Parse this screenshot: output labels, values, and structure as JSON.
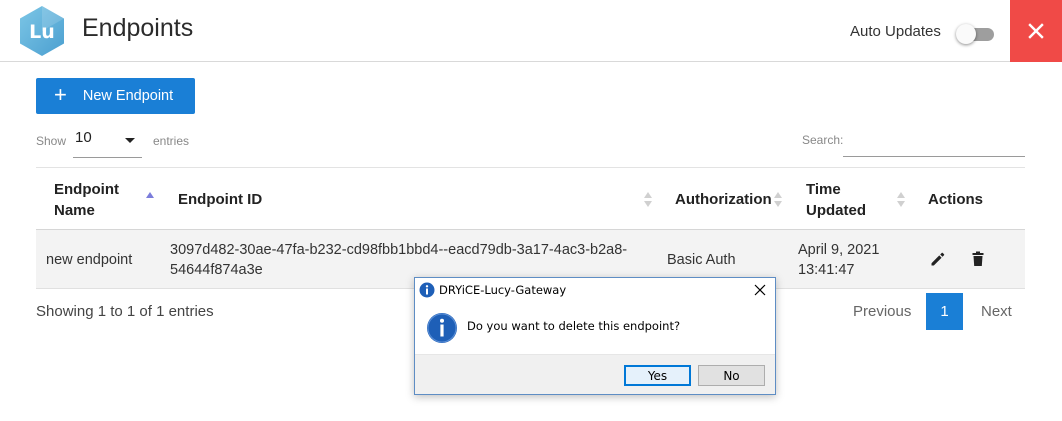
{
  "header": {
    "logo_text": "Lu",
    "title": "Endpoints",
    "auto_updates_label": "Auto Updates",
    "auto_updates_on": false
  },
  "toolbar": {
    "new_endpoint_icon": "plus-icon",
    "new_endpoint_label": "New Endpoint"
  },
  "table_controls": {
    "show_label": "Show",
    "entries_value": "10",
    "entries_label": "entries",
    "search_label": "Search:",
    "search_value": ""
  },
  "table": {
    "columns": [
      "Endpoint Name",
      "Endpoint ID",
      "Authorization",
      "Time Updated",
      "Actions"
    ],
    "sorted_column": "Endpoint Name",
    "rows": [
      {
        "name": "new endpoint",
        "id_line1": "3097d482-30ae-47fa-b232-cd98fbb1bbd4--eacd79db-3a17-4ac3-b2a8-",
        "id_line2": "54644f874a3e",
        "authorization": "Basic Auth",
        "time_line1": "April 9, 2021",
        "time_line2": "13:41:47",
        "actions": [
          "edit-icon",
          "delete-icon"
        ]
      }
    ]
  },
  "pagination": {
    "info": "Showing 1 to 1 of 1 entries",
    "previous": "Previous",
    "current_page": "1",
    "next": "Next"
  },
  "dialog": {
    "title": "DRYiCE-Lucy-Gateway",
    "message": "Do you want to delete this endpoint?",
    "yes_label": "Yes",
    "no_label": "No"
  },
  "colors": {
    "primary": "#1a7fd6",
    "close_bg": "#f04a47",
    "sort_active": "#7b7ddb"
  }
}
